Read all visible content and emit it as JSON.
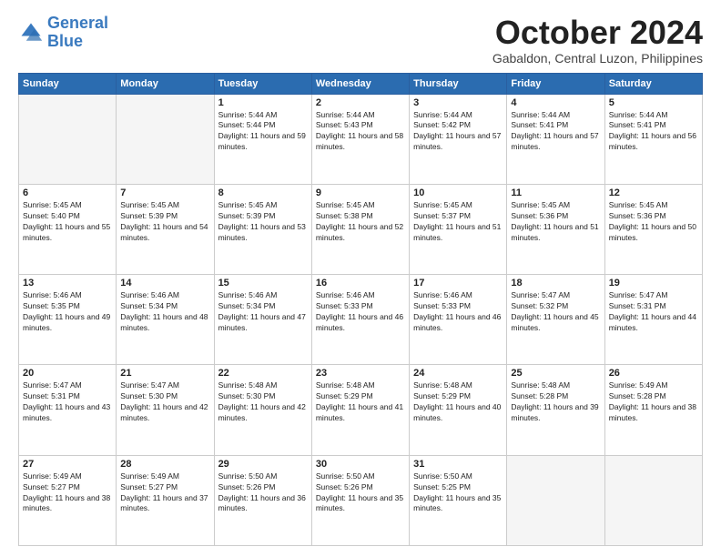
{
  "logo": {
    "line1": "General",
    "line2": "Blue"
  },
  "header": {
    "month": "October 2024",
    "location": "Gabaldon, Central Luzon, Philippines"
  },
  "weekdays": [
    "Sunday",
    "Monday",
    "Tuesday",
    "Wednesday",
    "Thursday",
    "Friday",
    "Saturday"
  ],
  "weeks": [
    [
      {
        "day": "",
        "info": ""
      },
      {
        "day": "",
        "info": ""
      },
      {
        "day": "1",
        "info": "Sunrise: 5:44 AM\nSunset: 5:44 PM\nDaylight: 11 hours and 59 minutes."
      },
      {
        "day": "2",
        "info": "Sunrise: 5:44 AM\nSunset: 5:43 PM\nDaylight: 11 hours and 58 minutes."
      },
      {
        "day": "3",
        "info": "Sunrise: 5:44 AM\nSunset: 5:42 PM\nDaylight: 11 hours and 57 minutes."
      },
      {
        "day": "4",
        "info": "Sunrise: 5:44 AM\nSunset: 5:41 PM\nDaylight: 11 hours and 57 minutes."
      },
      {
        "day": "5",
        "info": "Sunrise: 5:44 AM\nSunset: 5:41 PM\nDaylight: 11 hours and 56 minutes."
      }
    ],
    [
      {
        "day": "6",
        "info": "Sunrise: 5:45 AM\nSunset: 5:40 PM\nDaylight: 11 hours and 55 minutes."
      },
      {
        "day": "7",
        "info": "Sunrise: 5:45 AM\nSunset: 5:39 PM\nDaylight: 11 hours and 54 minutes."
      },
      {
        "day": "8",
        "info": "Sunrise: 5:45 AM\nSunset: 5:39 PM\nDaylight: 11 hours and 53 minutes."
      },
      {
        "day": "9",
        "info": "Sunrise: 5:45 AM\nSunset: 5:38 PM\nDaylight: 11 hours and 52 minutes."
      },
      {
        "day": "10",
        "info": "Sunrise: 5:45 AM\nSunset: 5:37 PM\nDaylight: 11 hours and 51 minutes."
      },
      {
        "day": "11",
        "info": "Sunrise: 5:45 AM\nSunset: 5:36 PM\nDaylight: 11 hours and 51 minutes."
      },
      {
        "day": "12",
        "info": "Sunrise: 5:45 AM\nSunset: 5:36 PM\nDaylight: 11 hours and 50 minutes."
      }
    ],
    [
      {
        "day": "13",
        "info": "Sunrise: 5:46 AM\nSunset: 5:35 PM\nDaylight: 11 hours and 49 minutes."
      },
      {
        "day": "14",
        "info": "Sunrise: 5:46 AM\nSunset: 5:34 PM\nDaylight: 11 hours and 48 minutes."
      },
      {
        "day": "15",
        "info": "Sunrise: 5:46 AM\nSunset: 5:34 PM\nDaylight: 11 hours and 47 minutes."
      },
      {
        "day": "16",
        "info": "Sunrise: 5:46 AM\nSunset: 5:33 PM\nDaylight: 11 hours and 46 minutes."
      },
      {
        "day": "17",
        "info": "Sunrise: 5:46 AM\nSunset: 5:33 PM\nDaylight: 11 hours and 46 minutes."
      },
      {
        "day": "18",
        "info": "Sunrise: 5:47 AM\nSunset: 5:32 PM\nDaylight: 11 hours and 45 minutes."
      },
      {
        "day": "19",
        "info": "Sunrise: 5:47 AM\nSunset: 5:31 PM\nDaylight: 11 hours and 44 minutes."
      }
    ],
    [
      {
        "day": "20",
        "info": "Sunrise: 5:47 AM\nSunset: 5:31 PM\nDaylight: 11 hours and 43 minutes."
      },
      {
        "day": "21",
        "info": "Sunrise: 5:47 AM\nSunset: 5:30 PM\nDaylight: 11 hours and 42 minutes."
      },
      {
        "day": "22",
        "info": "Sunrise: 5:48 AM\nSunset: 5:30 PM\nDaylight: 11 hours and 42 minutes."
      },
      {
        "day": "23",
        "info": "Sunrise: 5:48 AM\nSunset: 5:29 PM\nDaylight: 11 hours and 41 minutes."
      },
      {
        "day": "24",
        "info": "Sunrise: 5:48 AM\nSunset: 5:29 PM\nDaylight: 11 hours and 40 minutes."
      },
      {
        "day": "25",
        "info": "Sunrise: 5:48 AM\nSunset: 5:28 PM\nDaylight: 11 hours and 39 minutes."
      },
      {
        "day": "26",
        "info": "Sunrise: 5:49 AM\nSunset: 5:28 PM\nDaylight: 11 hours and 38 minutes."
      }
    ],
    [
      {
        "day": "27",
        "info": "Sunrise: 5:49 AM\nSunset: 5:27 PM\nDaylight: 11 hours and 38 minutes."
      },
      {
        "day": "28",
        "info": "Sunrise: 5:49 AM\nSunset: 5:27 PM\nDaylight: 11 hours and 37 minutes."
      },
      {
        "day": "29",
        "info": "Sunrise: 5:50 AM\nSunset: 5:26 PM\nDaylight: 11 hours and 36 minutes."
      },
      {
        "day": "30",
        "info": "Sunrise: 5:50 AM\nSunset: 5:26 PM\nDaylight: 11 hours and 35 minutes."
      },
      {
        "day": "31",
        "info": "Sunrise: 5:50 AM\nSunset: 5:25 PM\nDaylight: 11 hours and 35 minutes."
      },
      {
        "day": "",
        "info": ""
      },
      {
        "day": "",
        "info": ""
      }
    ]
  ]
}
